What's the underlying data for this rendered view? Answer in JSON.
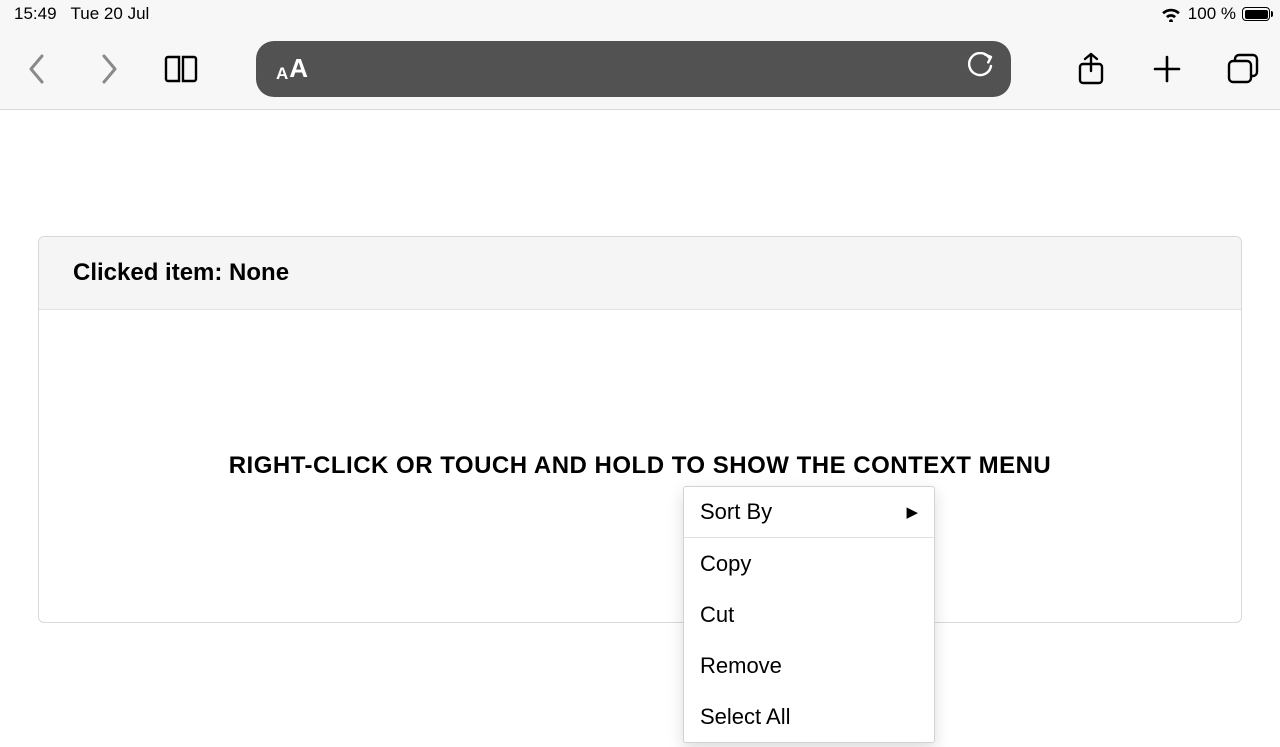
{
  "status": {
    "time": "15:49",
    "date": "Tue 20 Jul",
    "battery_pct": "100 %"
  },
  "panel": {
    "header_prefix": "Clicked item: ",
    "header_value": "None",
    "instruction": "RIGHT-CLICK OR TOUCH AND HOLD TO SHOW THE CONTEXT MENU"
  },
  "context_menu": {
    "items": [
      {
        "label": "Sort By",
        "has_submenu": true
      },
      {
        "label": "Copy"
      },
      {
        "label": "Cut"
      },
      {
        "label": "Remove"
      },
      {
        "label": "Select All"
      }
    ]
  }
}
